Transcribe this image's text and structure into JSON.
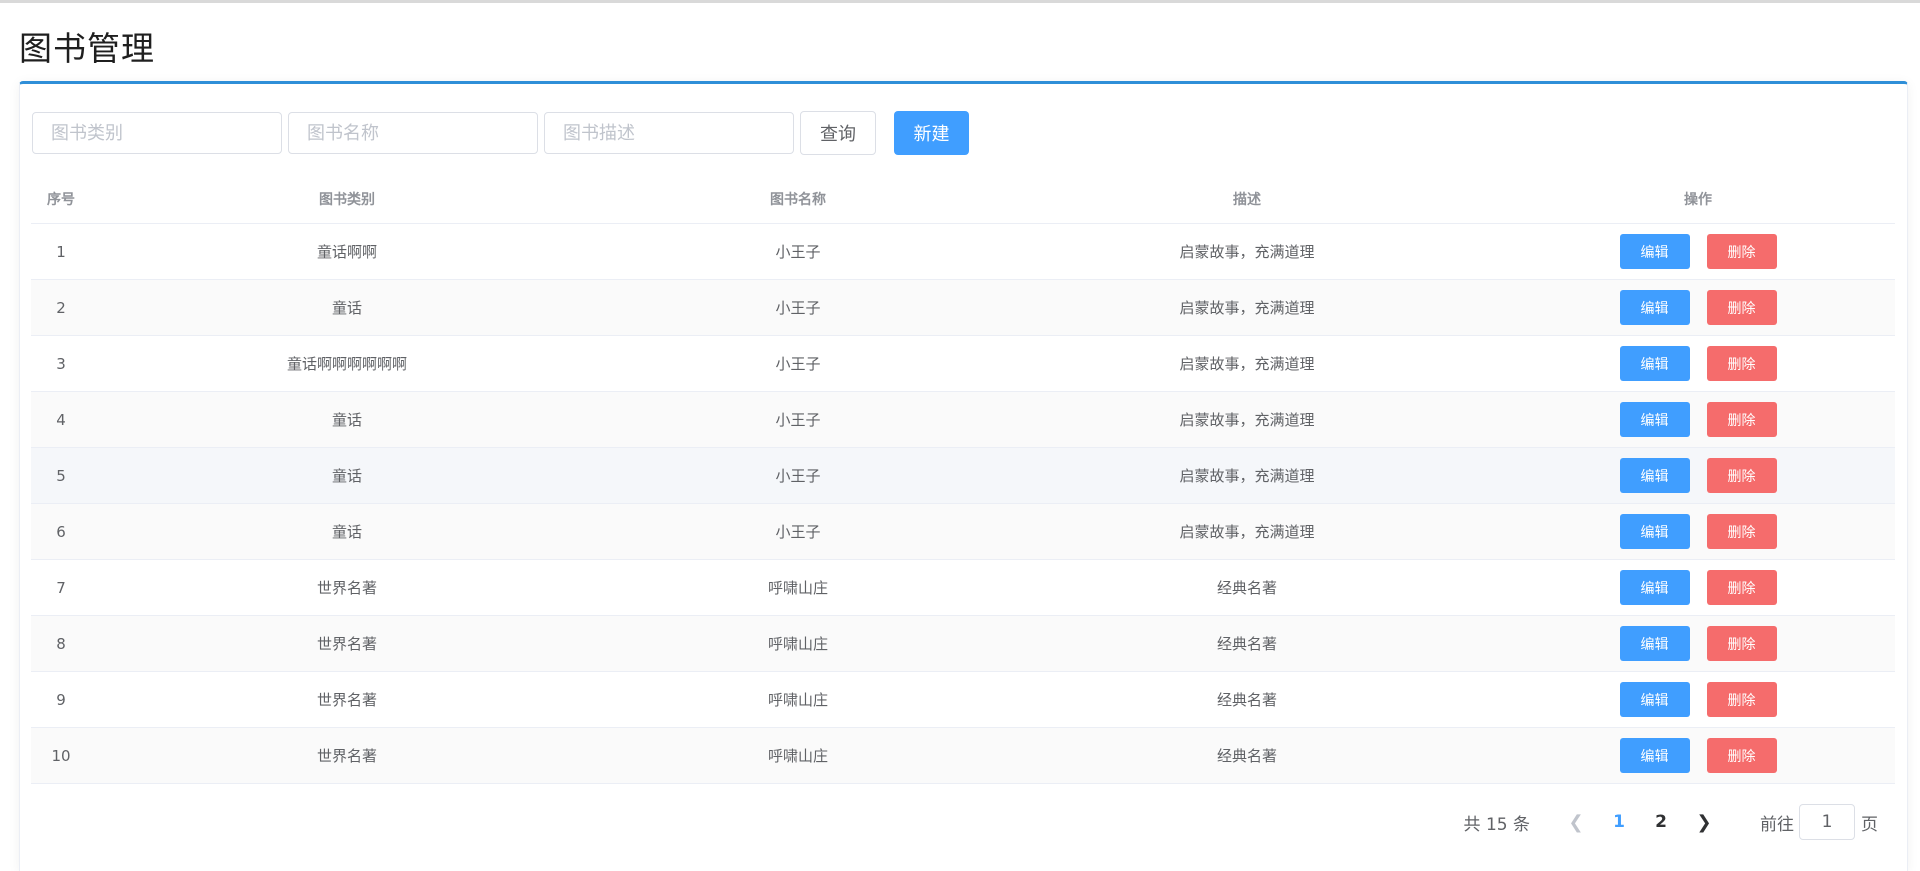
{
  "page": {
    "title": "图书管理"
  },
  "search": {
    "category_placeholder": "图书类别",
    "name_placeholder": "图书名称",
    "desc_placeholder": "图书描述",
    "query_label": "查询",
    "new_label": "新建"
  },
  "table": {
    "headers": {
      "index": "序号",
      "category": "图书类别",
      "name": "图书名称",
      "desc": "描述",
      "ops": "操作"
    },
    "edit_label": "编辑",
    "delete_label": "删除",
    "rows": [
      {
        "index": "1",
        "category": "童话啊啊",
        "name": "小王子",
        "desc": "启蒙故事，充满道理"
      },
      {
        "index": "2",
        "category": "童话",
        "name": "小王子",
        "desc": "启蒙故事，充满道理"
      },
      {
        "index": "3",
        "category": "童话啊啊啊啊啊啊",
        "name": "小王子",
        "desc": "启蒙故事，充满道理"
      },
      {
        "index": "4",
        "category": "童话",
        "name": "小王子",
        "desc": "启蒙故事，充满道理"
      },
      {
        "index": "5",
        "category": "童话",
        "name": "小王子",
        "desc": "启蒙故事，充满道理"
      },
      {
        "index": "6",
        "category": "童话",
        "name": "小王子",
        "desc": "启蒙故事，充满道理"
      },
      {
        "index": "7",
        "category": "世界名著",
        "name": "呼啸山庄",
        "desc": "经典名著"
      },
      {
        "index": "8",
        "category": "世界名著",
        "name": "呼啸山庄",
        "desc": "经典名著"
      },
      {
        "index": "9",
        "category": "世界名著",
        "name": "呼啸山庄",
        "desc": "经典名著"
      },
      {
        "index": "10",
        "category": "世界名著",
        "name": "呼啸山庄",
        "desc": "经典名著"
      }
    ]
  },
  "pagination": {
    "total": "共 15 条",
    "prev_icon": "chevron-left-icon",
    "next_icon": "chevron-right-icon",
    "pages": [
      "1",
      "2"
    ],
    "current": "1",
    "goto_label": "前往",
    "goto_value": "1",
    "page_suffix": "页"
  },
  "colors": {
    "primary": "#409eff",
    "danger": "#f56c6c",
    "accent_line": "#2f8fd8"
  }
}
